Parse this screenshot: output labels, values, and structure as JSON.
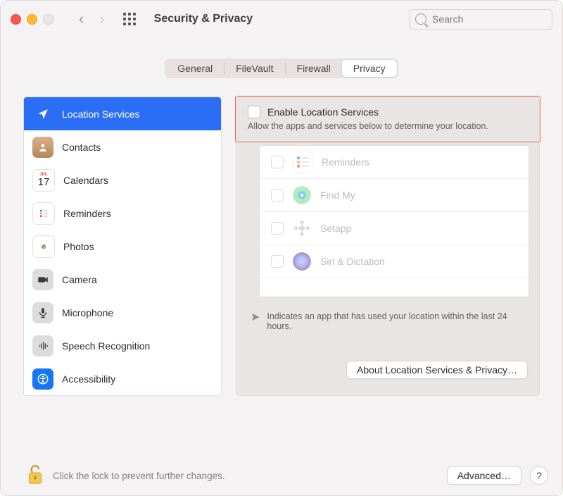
{
  "window": {
    "title": "Security & Privacy"
  },
  "search": {
    "placeholder": "Search"
  },
  "tabs": {
    "general": "General",
    "filevault": "FileVault",
    "firewall": "Firewall",
    "privacy": "Privacy"
  },
  "sidebar": {
    "items": [
      {
        "label": "Location Services",
        "icon": "location-arrow-icon",
        "bg": "#2a6ef5"
      },
      {
        "label": "Contacts",
        "icon": "contacts-icon",
        "bg": "#b88a5e"
      },
      {
        "label": "Calendars",
        "icon": "calendar-icon",
        "bg": "#ffffff"
      },
      {
        "label": "Reminders",
        "icon": "reminders-icon",
        "bg": "#ffffff"
      },
      {
        "label": "Photos",
        "icon": "photos-icon",
        "bg": "#ffffff"
      },
      {
        "label": "Camera",
        "icon": "camera-icon",
        "bg": "#dcdcdc"
      },
      {
        "label": "Microphone",
        "icon": "microphone-icon",
        "bg": "#dcdcdc"
      },
      {
        "label": "Speech Recognition",
        "icon": "speech-icon",
        "bg": "#dcdcdc"
      },
      {
        "label": "Accessibility",
        "icon": "accessibility-icon",
        "bg": "#1578f2"
      }
    ]
  },
  "right": {
    "enable_label": "Enable Location Services",
    "enable_sub": "Allow the apps and services below to determine your location.",
    "apps": [
      {
        "label": "Reminders",
        "icon": "reminders-icon"
      },
      {
        "label": "Find My",
        "icon": "findmy-icon"
      },
      {
        "label": "Setapp",
        "icon": "setapp-icon"
      },
      {
        "label": "Siri & Dictation",
        "icon": "siri-icon"
      }
    ],
    "indicator_text": "Indicates an app that has used your location within the last 24 hours.",
    "about_button": "About Location Services & Privacy…"
  },
  "footer": {
    "lock_text": "Click the lock to prevent further changes.",
    "advanced": "Advanced…",
    "help": "?"
  },
  "calendar_day": "17",
  "calendar_month": "JUL"
}
